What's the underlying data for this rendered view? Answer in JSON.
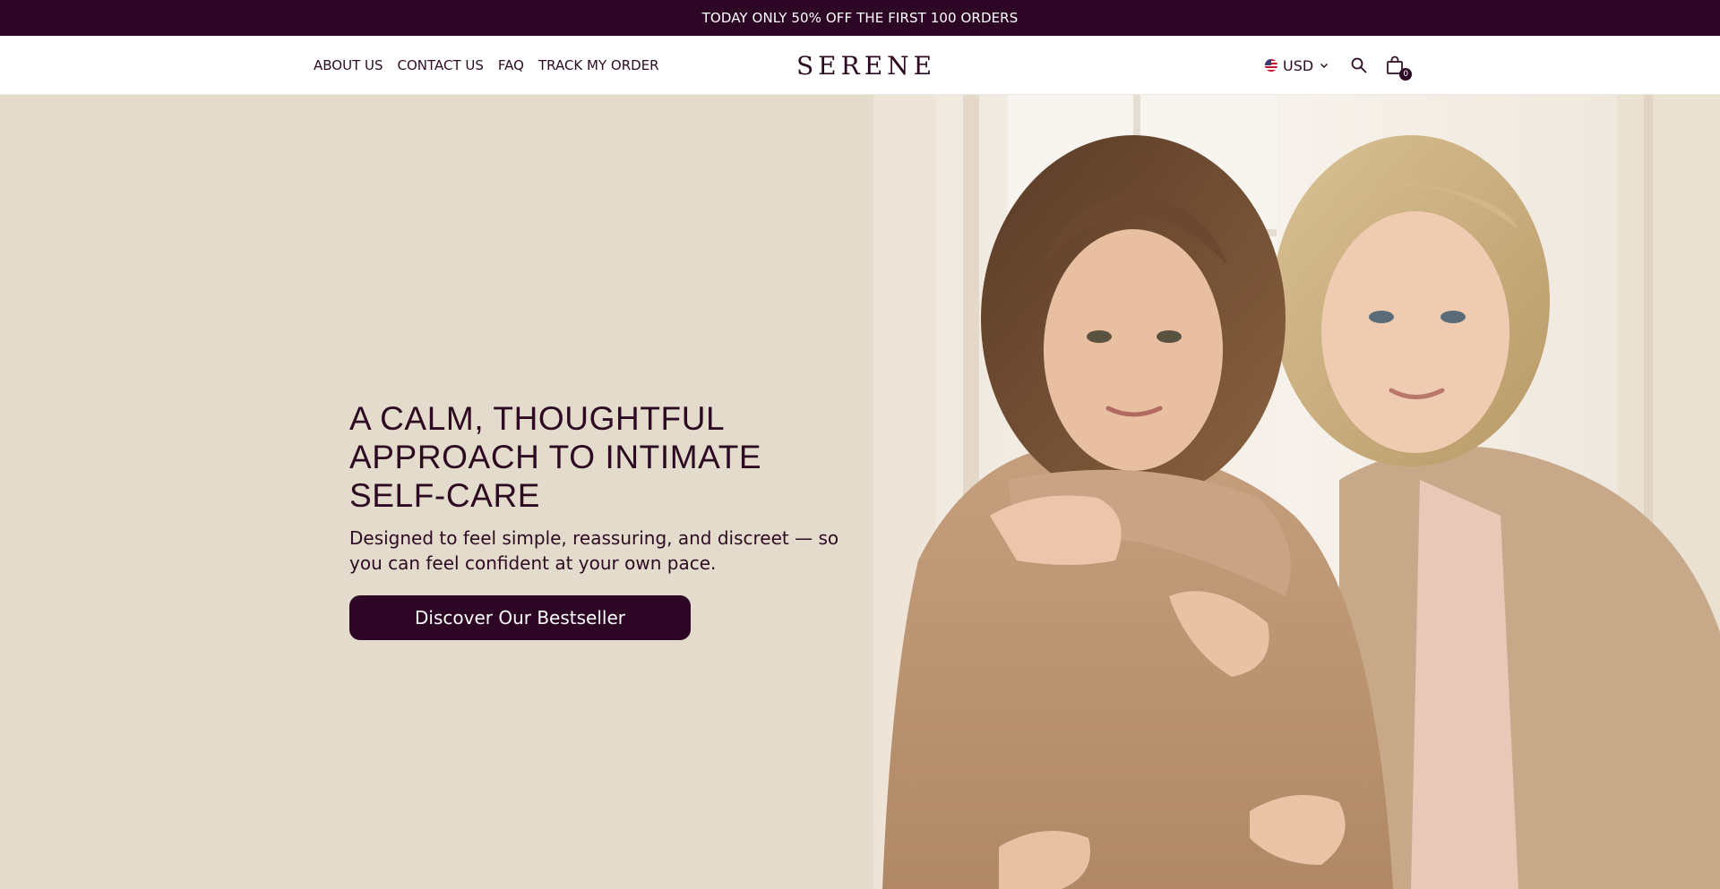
{
  "announcement": {
    "text": "TODAY ONLY 50% OFF THE FIRST 100 ORDERS"
  },
  "nav": {
    "items": [
      {
        "label": "ABOUT US"
      },
      {
        "label": "CONTACT US"
      },
      {
        "label": "FAQ"
      },
      {
        "label": "TRACK MY ORDER"
      }
    ]
  },
  "brand": {
    "logo": "SERENE"
  },
  "header_tools": {
    "currency": "USD",
    "cart_count": "0",
    "icons": [
      "us-flag-icon",
      "chevron-down-icon",
      "search-icon",
      "shopping-bag-icon"
    ]
  },
  "hero": {
    "title": "A CALM, THOUGHTFUL\nAPPROACH TO INTIMATE\nSELF-CARE",
    "subtitle": "Designed to feel simple, reassuring, and discreet — so you can feel confident at your own pace.",
    "cta_label": "Discover Our Bestseller"
  },
  "colors": {
    "brand_plum": "#2d0626",
    "hero_background": "#e3dccd",
    "text": "#2d0a22"
  }
}
